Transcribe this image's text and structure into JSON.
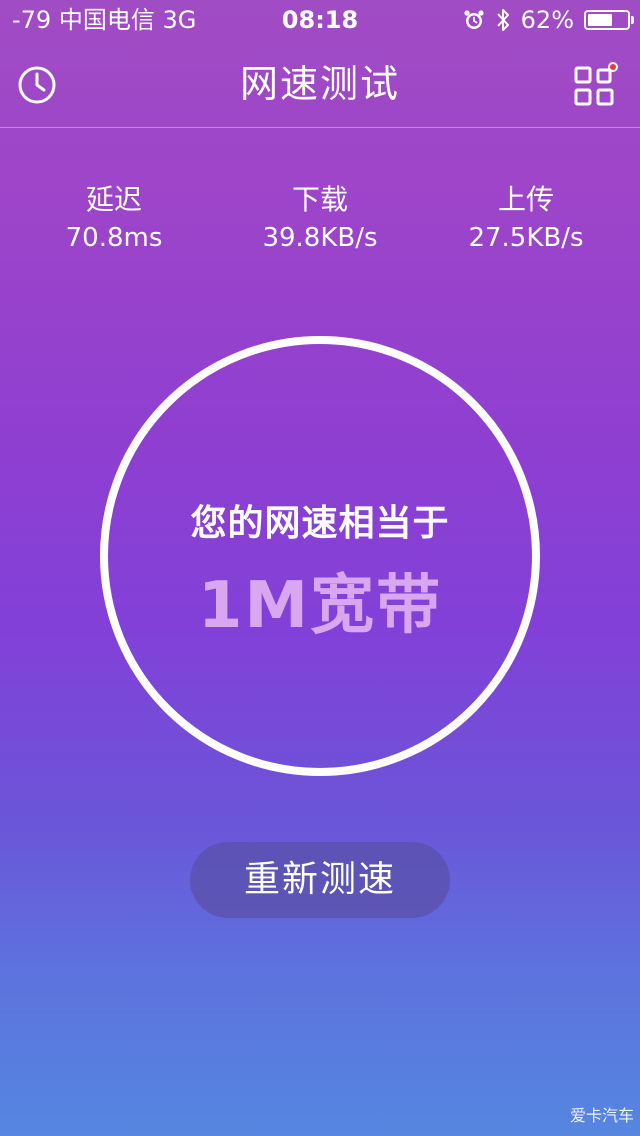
{
  "status_bar": {
    "carrier": "-79 中国电信   3G",
    "time": "08:18",
    "battery": "62%",
    "battery_level": 0.62,
    "icons": [
      "alarm-icon",
      "bluetooth-icon",
      "battery-icon"
    ]
  },
  "nav": {
    "title": "网速测试",
    "left_icon": "clock-icon",
    "right_icon": "grid-apps-icon",
    "notification_dot_color": "#e23b3b"
  },
  "stats": {
    "latency": {
      "label": "延迟",
      "value": "70.8ms"
    },
    "download": {
      "label": "下载",
      "value": "39.8KB/s"
    },
    "upload": {
      "label": "上传",
      "value": "27.5KB/s"
    }
  },
  "gauge": {
    "caption": "您的网速相当于",
    "result": "1M宽带",
    "result_color": "#d9a6f0"
  },
  "retest_button": {
    "label": "重新测速"
  },
  "watermark": "爱卡汽车",
  "colors": {
    "gradient_top": "#a04cc4",
    "gradient_mid": "#8240d8",
    "gradient_bottom": "#5586e0"
  }
}
